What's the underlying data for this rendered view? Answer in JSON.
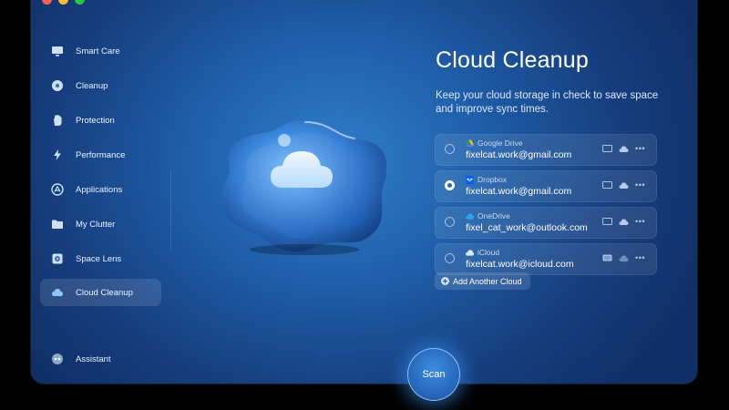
{
  "window": {
    "traffic_lights": [
      "close",
      "minimize",
      "zoom"
    ]
  },
  "sidebar": {
    "items": [
      {
        "label": "Smart Care",
        "icon": "display-icon"
      },
      {
        "label": "Cleanup",
        "icon": "cleanup-disc-icon"
      },
      {
        "label": "Protection",
        "icon": "hand-icon"
      },
      {
        "label": "Performance",
        "icon": "lightning-icon"
      },
      {
        "label": "Applications",
        "icon": "apps-icon"
      },
      {
        "label": "My Clutter",
        "icon": "folder-icon"
      },
      {
        "label": "Space Lens",
        "icon": "disk-icon"
      },
      {
        "label": "Cloud Cleanup",
        "icon": "cloud-icon",
        "active": true
      }
    ],
    "assistant": {
      "label": "Assistant",
      "icon": "assistant-icon"
    }
  },
  "main": {
    "title": "Cloud Cleanup",
    "subtitle": "Keep your cloud storage in check to save space and improve sync times.",
    "accounts": [
      {
        "provider": "Google Drive",
        "email": "fixelcat.work@gmail.com",
        "icon": "google-drive-icon",
        "selected": false
      },
      {
        "provider": "Dropbox",
        "email": "fixelcat.work@gmail.com",
        "icon": "dropbox-icon",
        "selected": true
      },
      {
        "provider": "OneDrive",
        "email": "fixel_cat_work@outlook.com",
        "icon": "onedrive-icon",
        "selected": false
      },
      {
        "provider": "iCloud",
        "email": "fixelcat.work@icloud.com",
        "icon": "icloud-icon",
        "selected": false
      }
    ],
    "add_cloud_label": "Add Another Cloud",
    "scan_label": "Scan"
  },
  "colors": {
    "accent": "#2a6cbf",
    "window_bg": "#1f5ea9",
    "scan_glow": "#378ceb"
  }
}
